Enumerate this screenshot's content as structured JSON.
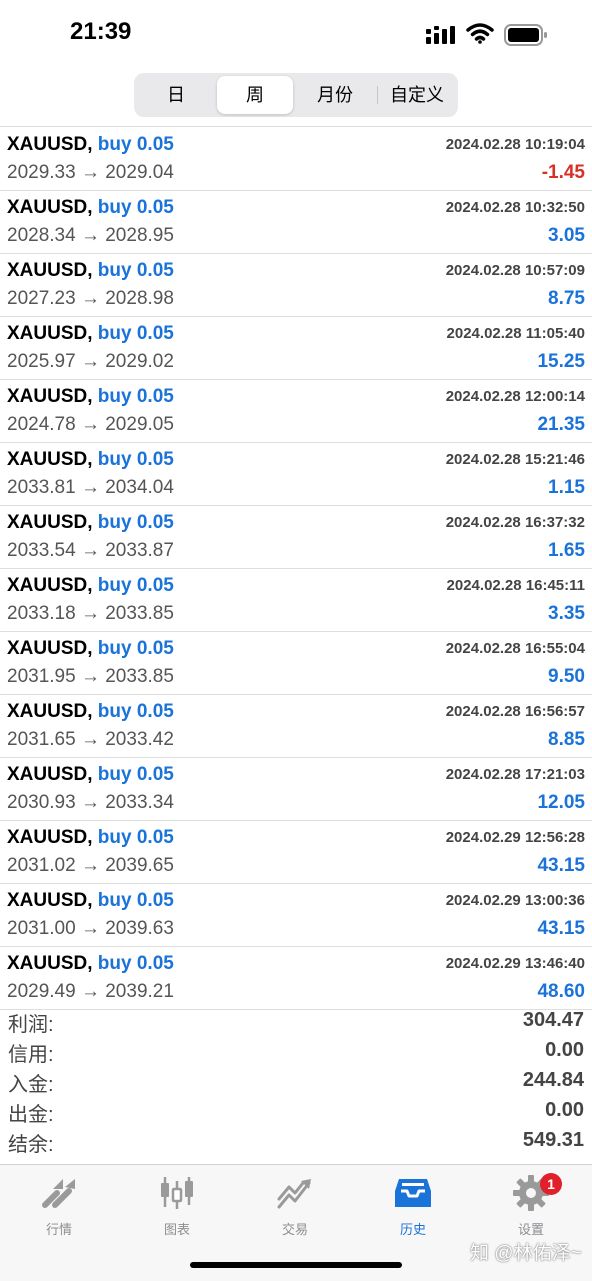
{
  "status": {
    "time": "21:39"
  },
  "segments": {
    "day": "日",
    "week": "周",
    "month": "月份",
    "custom": "自定义"
  },
  "trades": [
    {
      "symbol": "XAUUSD,",
      "side": "buy 0.05",
      "datetime": "2024.02.28 10:19:04",
      "prices": "2029.33 → 2029.04",
      "profit": "-1.45"
    },
    {
      "symbol": "XAUUSD,",
      "side": "buy 0.05",
      "datetime": "2024.02.28 10:32:50",
      "prices": "2028.34 → 2028.95",
      "profit": "3.05"
    },
    {
      "symbol": "XAUUSD,",
      "side": "buy 0.05",
      "datetime": "2024.02.28 10:57:09",
      "prices": "2027.23 → 2028.98",
      "profit": "8.75"
    },
    {
      "symbol": "XAUUSD,",
      "side": "buy 0.05",
      "datetime": "2024.02.28 11:05:40",
      "prices": "2025.97 → 2029.02",
      "profit": "15.25"
    },
    {
      "symbol": "XAUUSD,",
      "side": "buy 0.05",
      "datetime": "2024.02.28 12:00:14",
      "prices": "2024.78 → 2029.05",
      "profit": "21.35"
    },
    {
      "symbol": "XAUUSD,",
      "side": "buy 0.05",
      "datetime": "2024.02.28 15:21:46",
      "prices": "2033.81 → 2034.04",
      "profit": "1.15"
    },
    {
      "symbol": "XAUUSD,",
      "side": "buy 0.05",
      "datetime": "2024.02.28 16:37:32",
      "prices": "2033.54 → 2033.87",
      "profit": "1.65"
    },
    {
      "symbol": "XAUUSD,",
      "side": "buy 0.05",
      "datetime": "2024.02.28 16:45:11",
      "prices": "2033.18 → 2033.85",
      "profit": "3.35"
    },
    {
      "symbol": "XAUUSD,",
      "side": "buy 0.05",
      "datetime": "2024.02.28 16:55:04",
      "prices": "2031.95 → 2033.85",
      "profit": "9.50"
    },
    {
      "symbol": "XAUUSD,",
      "side": "buy 0.05",
      "datetime": "2024.02.28 16:56:57",
      "prices": "2031.65 → 2033.42",
      "profit": "8.85"
    },
    {
      "symbol": "XAUUSD,",
      "side": "buy 0.05",
      "datetime": "2024.02.28 17:21:03",
      "prices": "2030.93 → 2033.34",
      "profit": "12.05"
    },
    {
      "symbol": "XAUUSD,",
      "side": "buy 0.05",
      "datetime": "2024.02.29 12:56:28",
      "prices": "2031.02 → 2039.65",
      "profit": "43.15"
    },
    {
      "symbol": "XAUUSD,",
      "side": "buy 0.05",
      "datetime": "2024.02.29 13:00:36",
      "prices": "2031.00 → 2039.63",
      "profit": "43.15"
    },
    {
      "symbol": "XAUUSD,",
      "side": "buy 0.05",
      "datetime": "2024.02.29 13:46:40",
      "prices": "2029.49 → 2039.21",
      "profit": "48.60"
    }
  ],
  "summary": {
    "profit_label": "利润:",
    "profit_value": "304.47",
    "credit_label": "信用:",
    "credit_value": "0.00",
    "deposit_label": "入金:",
    "deposit_value": "244.84",
    "withdraw_label": "出金:",
    "withdraw_value": "0.00",
    "balance_label": "结余:",
    "balance_value": "549.31"
  },
  "tabs": {
    "quotes": "行情",
    "charts": "图表",
    "trade": "交易",
    "history": "历史",
    "settings": "设置",
    "settings_badge": "1"
  },
  "watermark": "知 @林佑泽~",
  "colors": {
    "accent": "#1a73d9",
    "loss": "#d93025",
    "badge": "#e0202b"
  }
}
